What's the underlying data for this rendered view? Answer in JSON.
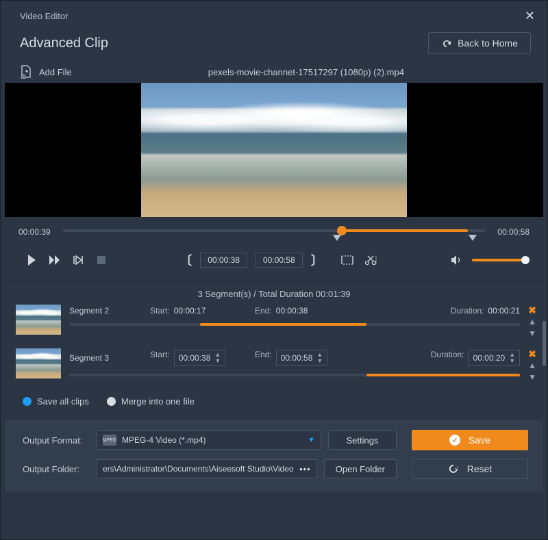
{
  "titlebar": {
    "title": "Video Editor"
  },
  "header": {
    "page_title": "Advanced Clip",
    "back_label": "Back to Home"
  },
  "filebar": {
    "add_label": "Add File",
    "filename": "pexels-movie-channet-17517297 (1080p) (2).mp4"
  },
  "timeline": {
    "current": "00:00:39",
    "total": "00:00:58",
    "fill_left_pct": 66,
    "fill_right_pct": 4,
    "marker_in_pct": 65,
    "marker_out_pct": 97
  },
  "controls": {
    "in_time": "00:00:38",
    "out_time": "00:00:58"
  },
  "summary": {
    "text": "3 Segment(s) / Total Duration 00:01:39"
  },
  "segments": [
    {
      "name": "Segment 2",
      "start_label": "Start:",
      "start": "00:00:17",
      "end_label": "End:",
      "end": "00:00:38",
      "dur_label": "Duration:",
      "duration": "00:00:21",
      "editable": false,
      "fill_left_pct": 29,
      "fill_width_pct": 37
    },
    {
      "name": "Segment 3",
      "start_label": "Start:",
      "start": "00:00:38",
      "end_label": "End:",
      "end": "00:00:58",
      "dur_label": "Duration:",
      "duration": "00:00:20",
      "editable": true,
      "fill_left_pct": 66,
      "fill_width_pct": 34
    }
  ],
  "options": {
    "save_all": "Save all clips",
    "merge": "Merge into one file"
  },
  "output": {
    "format_label": "Output Format:",
    "format_value": "MPEG-4 Video (*.mp4)",
    "settings_label": "Settings",
    "folder_label": "Output Folder:",
    "folder_value": "ers\\Administrator\\Documents\\Aiseesoft Studio\\Video",
    "open_label": "Open Folder",
    "save_label": "Save",
    "reset_label": "Reset"
  }
}
